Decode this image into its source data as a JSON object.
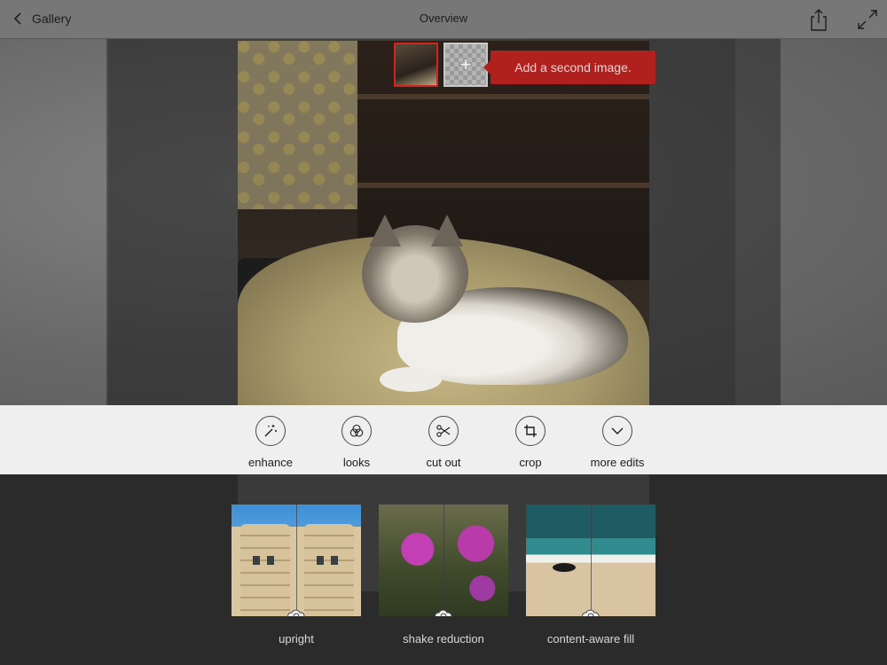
{
  "header": {
    "back_label": "Gallery",
    "title": "Overview",
    "icons": [
      "back-chevron-icon",
      "share-icon",
      "fullscreen-icon"
    ]
  },
  "photo": {
    "subject": "cat on blanket",
    "add_image_callout": "Add a second image.",
    "thumbnails": [
      {
        "name": "current-image",
        "selected": true
      },
      {
        "name": "add-image",
        "symbol": "+"
      }
    ]
  },
  "tools": [
    {
      "id": "enhance",
      "label": "enhance",
      "icon": "magic-wand-icon"
    },
    {
      "id": "looks",
      "label": "looks",
      "icon": "looks-circles-icon"
    },
    {
      "id": "cut_out",
      "label": "cut out",
      "icon": "scissors-icon"
    },
    {
      "id": "crop",
      "label": "crop",
      "icon": "crop-icon"
    },
    {
      "id": "more_edits",
      "label": "more edits",
      "icon": "chevron-down-icon"
    }
  ],
  "features": [
    {
      "id": "upright",
      "label": "upright",
      "badge_icon": "creative-cloud-icon"
    },
    {
      "id": "shake_reduction",
      "label": "shake reduction",
      "badge_icon": "creative-cloud-icon"
    },
    {
      "id": "content_aware_fill",
      "label": "content-aware fill",
      "badge_icon": "creative-cloud-icon"
    }
  ],
  "colors": {
    "accent_red": "#d6221e",
    "callout_bg": "#b0201d",
    "toolbar_bg": "#f5f5f5",
    "bottom_bg": "#2b2b2b"
  }
}
